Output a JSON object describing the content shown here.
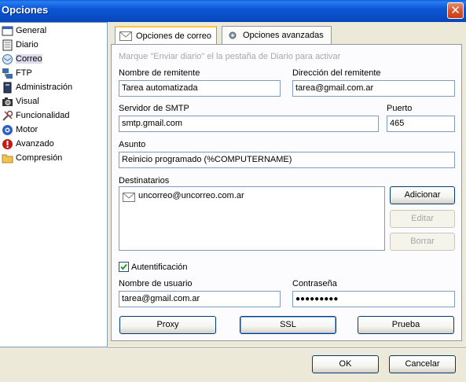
{
  "window": {
    "title": "Opciones",
    "close_glyph": "✕"
  },
  "sidebar": {
    "items": [
      {
        "label": "General",
        "icon": "window-icon"
      },
      {
        "label": "Diario",
        "icon": "notebook-icon"
      },
      {
        "label": "Correo",
        "icon": "mail-icon"
      },
      {
        "label": "FTP",
        "icon": "network-icon"
      },
      {
        "label": "Administración",
        "icon": "admin-icon"
      },
      {
        "label": "Visual",
        "icon": "camera-icon"
      },
      {
        "label": "Funcionalidad",
        "icon": "tools-icon"
      },
      {
        "label": "Motor",
        "icon": "engine-icon"
      },
      {
        "label": "Avanzado",
        "icon": "warning-icon"
      },
      {
        "label": "Compresión",
        "icon": "folder-icon"
      }
    ],
    "selected": "Correo"
  },
  "tabs": [
    {
      "label": "Opciones de correo",
      "icon": "envelope-icon"
    },
    {
      "label": "Opciones avanzadas",
      "icon": "gear-icon"
    }
  ],
  "hint": "Marque \"Enviar diario\" el la pestaña de Diario para activar",
  "form": {
    "sender_name_label": "Nombre de remitente",
    "sender_name_value": "Tarea automatizada",
    "sender_address_label": "Dirección del remitente",
    "sender_address_value": "tarea@gmail.com.ar",
    "smtp_label": "Servidor de SMTP",
    "smtp_value": "smtp.gmail.com",
    "port_label": "Puerto",
    "port_value": "465",
    "subject_label": "Asunto",
    "subject_value": "Reinicio programado (%COMPUTERNAME)",
    "recipients_label": "Destinatarios",
    "recipients": [
      "uncorreo@uncorreo.com.ar"
    ],
    "add_button": "Adicionar",
    "edit_button": "Editar",
    "delete_button": "Borrar",
    "auth_label": "Autentificación",
    "auth_checked": true,
    "username_label": "Nombre de usuario",
    "username_value": "tarea@gmail.com.ar",
    "password_label": "Contraseña",
    "password_value": "●●●●●●●●●",
    "proxy_button": "Proxy",
    "ssl_button": "SSL",
    "test_button": "Prueba"
  },
  "footer": {
    "ok_button": "OK",
    "cancel_button": "Cancelar"
  }
}
